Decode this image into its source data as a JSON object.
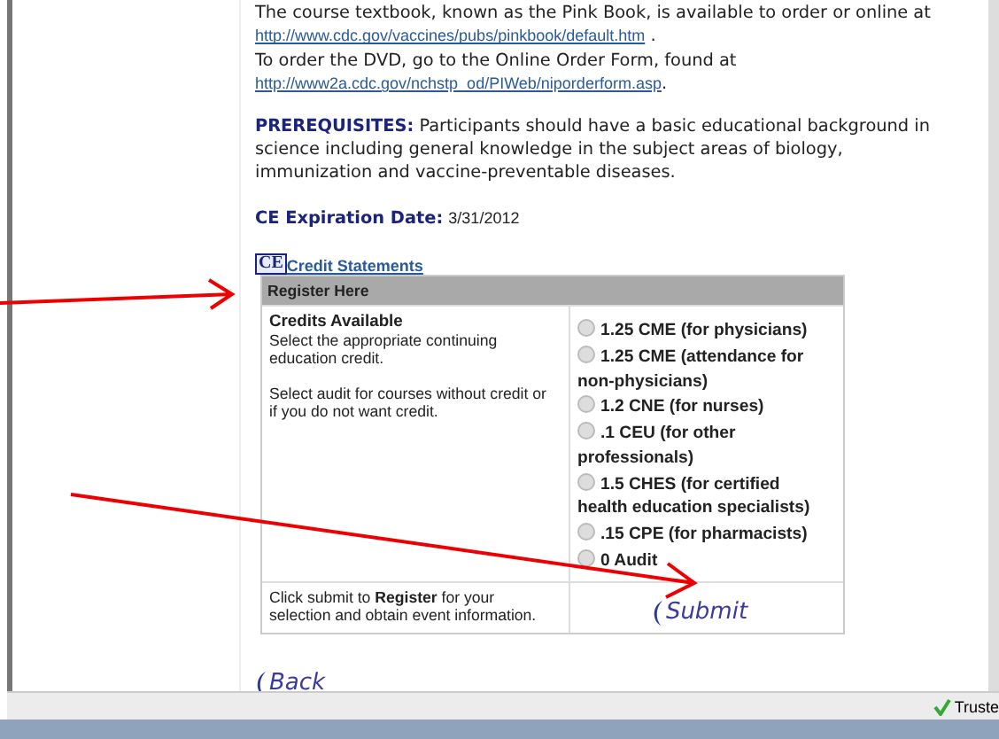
{
  "textbook": {
    "line_1": "The course textbook, known as the Pink Book, is available to order or online at",
    "link_1": "http://www.cdc.gov/vaccines/pubs/pinkbook/default.htm",
    "after_link_1": " .",
    "line_2": "To order the DVD, go to the Online Order Form, found at",
    "link_2": "http://www2a.cdc.gov/nchstp_od/PIWeb/niporderform.asp",
    "after_link_2": "."
  },
  "prerequisites": {
    "label": "PREREQUISITES:",
    "text": "Participants should have a basic educational background in science including general knowledge in the subject areas of biology, immunization and vaccine-preventable diseases."
  },
  "expiration": {
    "label": "CE Expiration Date:",
    "value": "3/31/2012"
  },
  "credit_statements": {
    "badge": "CE",
    "link": "Credit Statements"
  },
  "register": {
    "header": "Register Here",
    "credits_title": "Credits Available",
    "credits_text": "Select the appropriate continuing education credit.",
    "audit_text": "Select audit for courses without credit or if you do not want credit.",
    "options": [
      {
        "label": "1.25 CME (for physicians)",
        "selected": false
      },
      {
        "label": "1.25 CME (attendance for non-physicians)",
        "selected": false
      },
      {
        "label": "1.2 CNE (for nurses)",
        "selected": false
      },
      {
        "label": ".1 CEU (for other professionals)",
        "selected": false
      },
      {
        "label": "1.5 CHES (for certified health education specialists)",
        "selected": false
      },
      {
        "label": ".15 CPE (for pharmacists)",
        "selected": false
      },
      {
        "label": "0 Audit",
        "selected": false
      }
    ],
    "submit_text": "Click submit to **Register** for your selection and obtain event information.",
    "submit_button": "Submit"
  },
  "back_button": "Back",
  "status_bar": {
    "zone": "Truste"
  }
}
